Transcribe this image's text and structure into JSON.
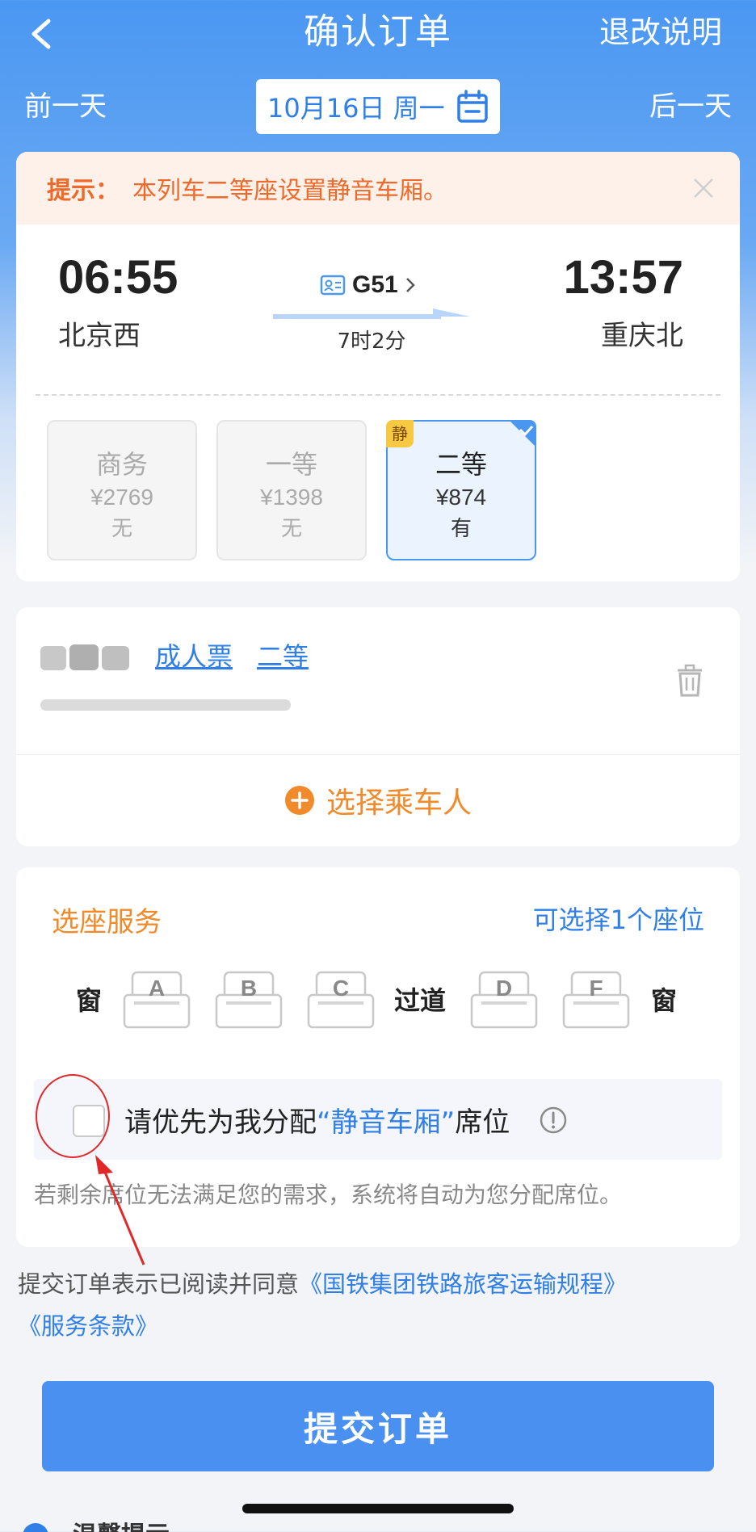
{
  "header": {
    "title": "确认订单",
    "refund_label": "退改说明",
    "prev_day": "前一天",
    "next_day": "后一天",
    "date": "10月16日 周一"
  },
  "notice": {
    "label": "提示：",
    "text": "本列车二等座设置静音车厢。"
  },
  "train": {
    "departure_time": "06:55",
    "departure_station": "北京西",
    "arrival_time": "13:57",
    "arrival_station": "重庆北",
    "train_number": "G51",
    "duration": "7时2分"
  },
  "seat_classes": [
    {
      "name": "商务",
      "price": "¥2769",
      "availability": "无",
      "selected": false
    },
    {
      "name": "一等",
      "price": "¥1398",
      "availability": "无",
      "selected": false
    },
    {
      "name": "二等",
      "price": "¥874",
      "availability": "有",
      "selected": true,
      "badge": "静"
    }
  ],
  "passenger": {
    "ticket_type": "成人票",
    "seat_class": "二等",
    "add_label": "选择乘车人"
  },
  "seat_selection": {
    "title": "选座服务",
    "count_hint": "可选择1个座位",
    "window_left": "窗",
    "aisle": "过道",
    "window_right": "窗",
    "seats": [
      "A",
      "B",
      "C",
      "D",
      "F"
    ],
    "quiet_prefix": "请优先为我分配",
    "quiet_highlight": "“静音车厢”",
    "quiet_suffix": "席位",
    "fallback_note": "若剩余席位无法满足您的需求，系统将自动为您分配席位。"
  },
  "agreement": {
    "prefix": "提交订单表示已阅读并同意",
    "link1": "《国铁集团铁路旅客运输规程》",
    "link2": "《服务条款》"
  },
  "submit_label": "提交订单",
  "tip_label": "温馨提示",
  "colors": {
    "brand_blue": "#4a97f2",
    "link_blue": "#2f7fe7",
    "accent_orange": "#f08a2a",
    "annotation_red": "#e0282a"
  }
}
